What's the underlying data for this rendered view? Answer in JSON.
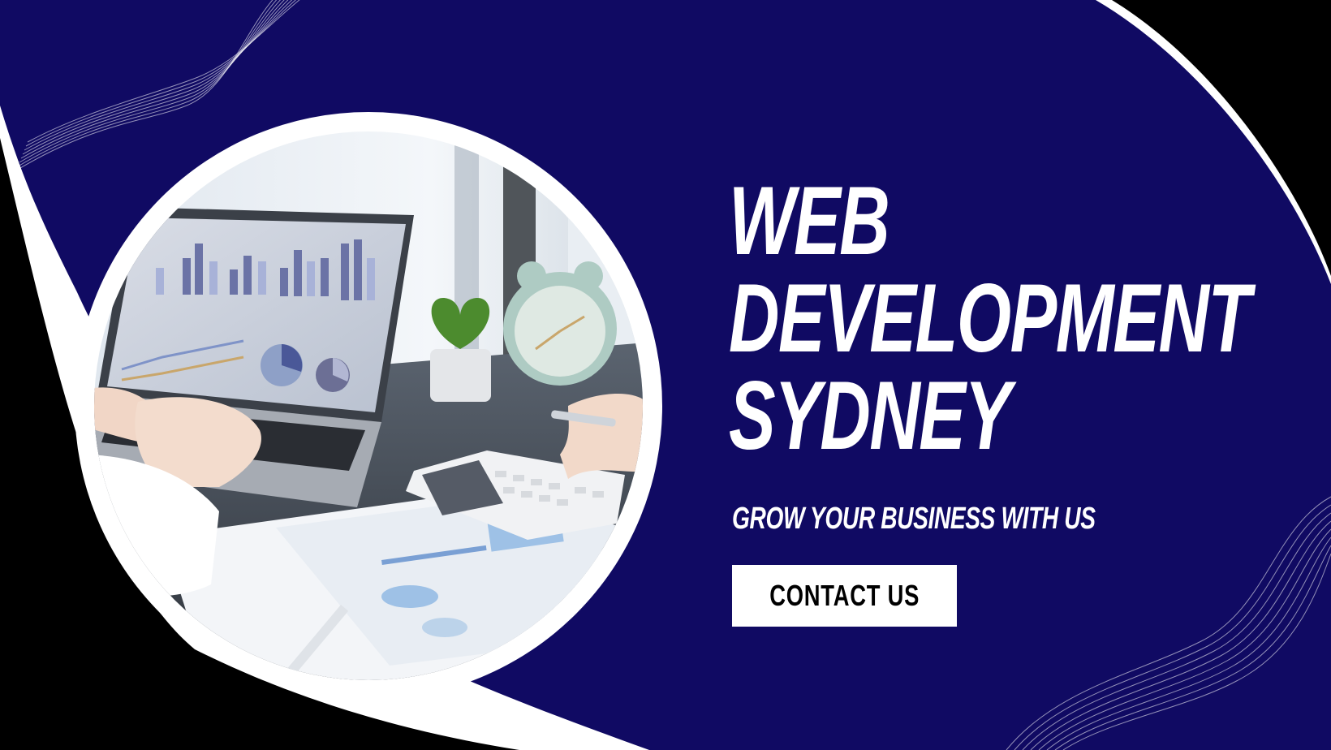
{
  "headline": {
    "line1": "WEB",
    "line2": "DEVELOPMENT",
    "line3": "SYDNEY"
  },
  "tagline": "GROW YOUR BUSINESS WITH US",
  "cta": {
    "label": "CONTACT US"
  },
  "colors": {
    "navy": "#100a63",
    "white": "#ffffff",
    "black": "#000000"
  }
}
